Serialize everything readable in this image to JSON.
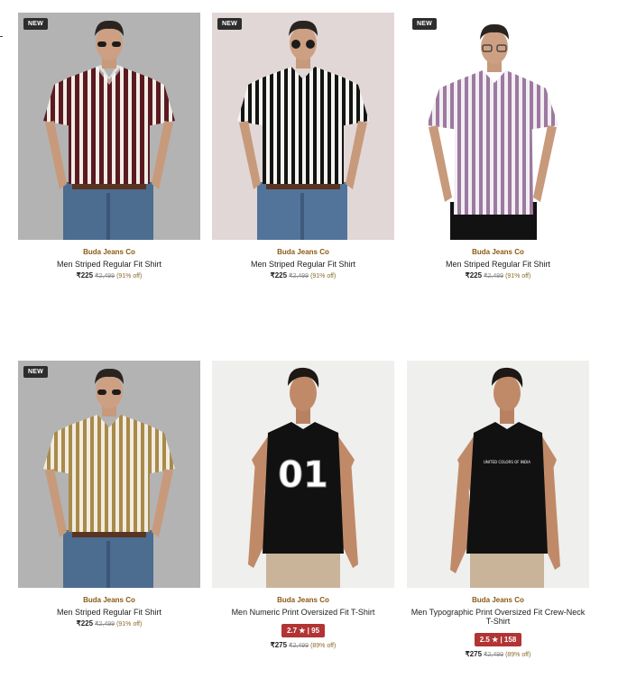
{
  "theme": {
    "brand_color": "#8a5a12",
    "rating_color": "#b23434",
    "badge_color": "#2d2d2d"
  },
  "products": [
    {
      "badge": "NEW",
      "image": "maroon-striped-shirt-model",
      "brand": "Buda Jeans Co",
      "title": "Men Striped Regular Fit Shirt",
      "price": "₹225",
      "mrp": "₹2,499",
      "discount": "(91% off)"
    },
    {
      "badge": "NEW",
      "image": "black-striped-shirt-model",
      "brand": "Buda Jeans Co",
      "title": "Men Striped Regular Fit Shirt",
      "price": "₹225",
      "mrp": "₹2,499",
      "discount": "(91% off)"
    },
    {
      "badge": "NEW",
      "image": "lavender-striped-shirt-model",
      "brand": "Buda Jeans Co",
      "title": "Men Striped Regular Fit Shirt",
      "price": "₹225",
      "mrp": "₹2,499",
      "discount": "(91% off)"
    },
    {
      "badge": "NEW",
      "image": "mustard-striped-shirt-model",
      "brand": "Buda Jeans Co",
      "title": "Men Striped Regular Fit Shirt",
      "price": "₹225",
      "mrp": "₹2,499",
      "discount": "(91% off)"
    },
    {
      "image": "numeric-print-tshirt-model",
      "brand": "Buda Jeans Co",
      "title": "Men Numeric Print Oversized Fit T-Shirt",
      "rating": "2.7 ★ | 95",
      "price": "₹275",
      "mrp": "₹2,499",
      "discount": "(89% off)"
    },
    {
      "image": "typographic-print-tshirt-model",
      "brand": "Buda Jeans Co",
      "title": "Men Typographic Print Oversized Fit Crew-Neck T-Shirt",
      "rating": "2.5 ★ | 158",
      "price": "₹275",
      "mrp": "₹2,499",
      "discount": "(89% off)"
    }
  ],
  "print_texts": {
    "numeric": "01",
    "typographic": "UNITED COLORS OF INDIA"
  }
}
